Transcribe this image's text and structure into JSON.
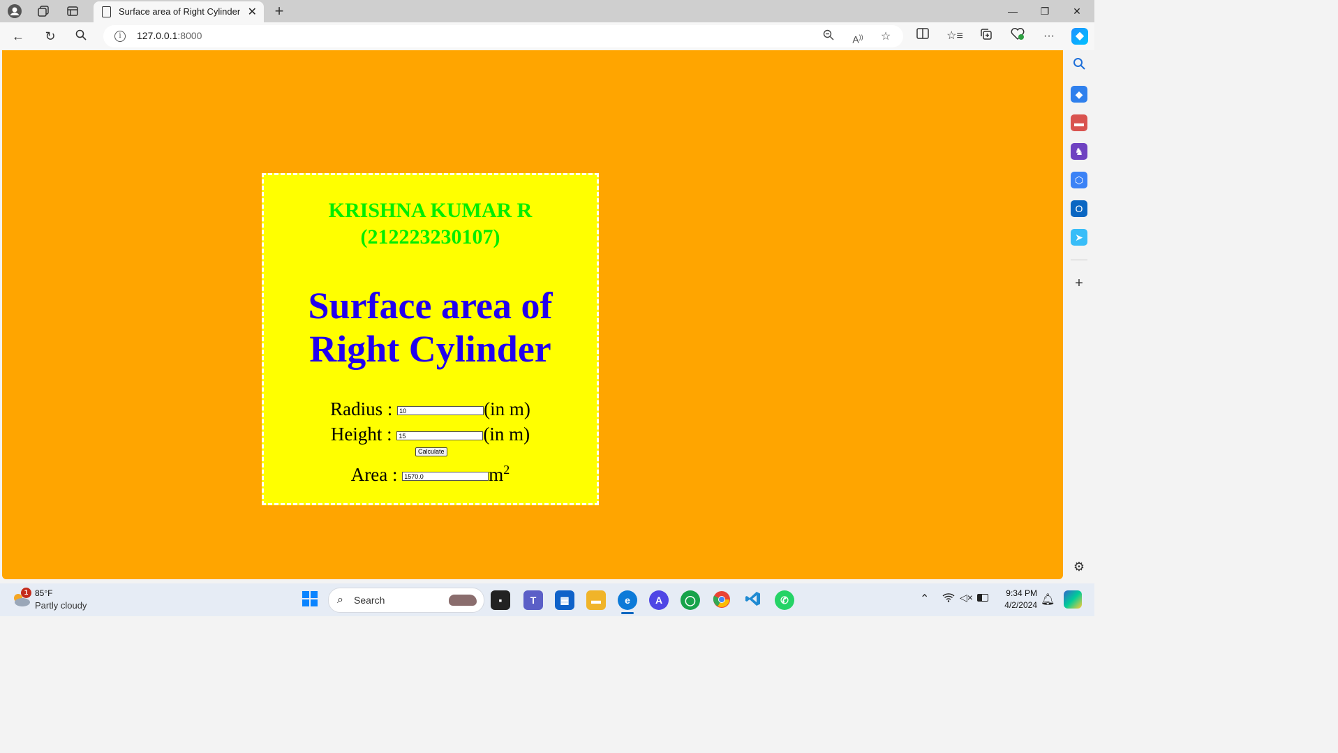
{
  "browser": {
    "tab_title": "Surface area of Right Cylinder",
    "url_host": "127.0.0.1",
    "url_port": ":8000"
  },
  "page": {
    "author": "KRISHNA KUMAR R",
    "roll_number": "(212223230107)",
    "heading": "Surface area of Right Cylinder",
    "radius_label": "Radius :",
    "radius_value": "10",
    "radius_unit": "(in m)",
    "height_label": "Height :",
    "height_value": "15",
    "height_unit": "(in m)",
    "calculate_label": "Calculate",
    "area_label": "Area :",
    "area_value": "1570.0",
    "area_unit": "m",
    "area_unit_exp": "2"
  },
  "colors": {
    "page_bg": "#ffa500",
    "card_bg": "#ffff00",
    "author": "#00ee00",
    "heading": "#2200ee"
  },
  "taskbar": {
    "weather_temp": "85°F",
    "weather_desc": "Partly cloudy",
    "weather_badge": "1",
    "search_label": "Search",
    "time": "9:34 PM",
    "date": "4/2/2024"
  }
}
